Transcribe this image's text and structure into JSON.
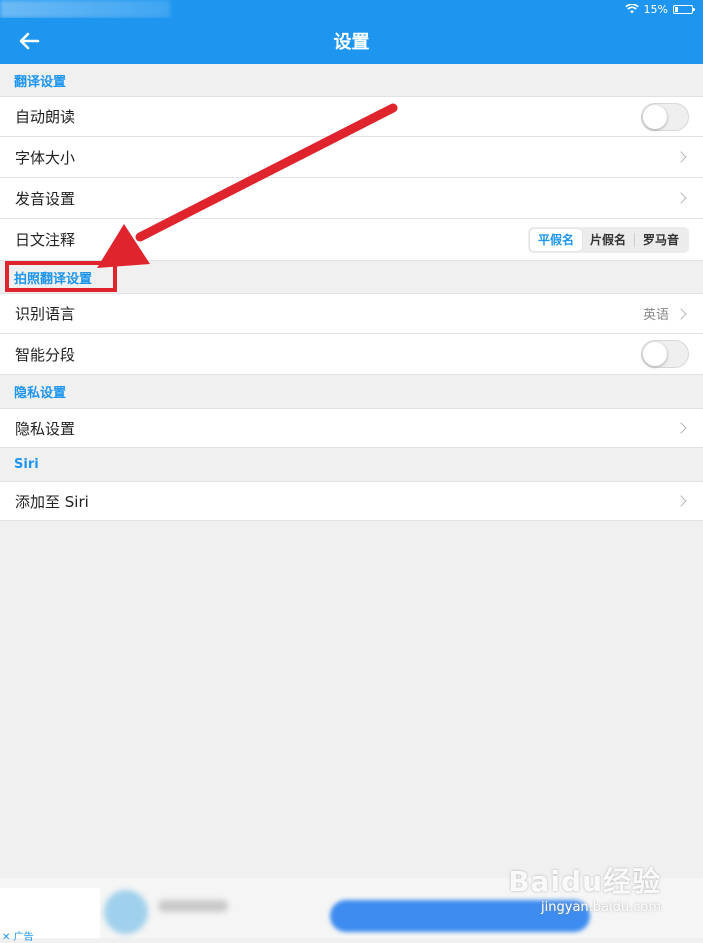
{
  "status_bar": {
    "battery_text": "15%"
  },
  "nav": {
    "title": "设置"
  },
  "sections": {
    "translation": {
      "title": "翻译设置",
      "rows": {
        "auto_read": {
          "label": "自动朗读",
          "toggle_on": false
        },
        "font_size": {
          "label": "字体大小"
        },
        "pronunciation": {
          "label": "发音设置"
        },
        "japanese_annotation": {
          "label": "日文注释",
          "options": [
            "平假名",
            "片假名",
            "罗马音"
          ],
          "selected": "平假名"
        }
      }
    },
    "photo_translation": {
      "title": "拍照翻译设置",
      "rows": {
        "recognize_language": {
          "label": "识别语言",
          "value": "英语"
        },
        "smart_paragraph": {
          "label": "智能分段",
          "toggle_on": false
        }
      }
    },
    "privacy": {
      "title": "隐私设置",
      "rows": {
        "privacy_settings": {
          "label": "隐私设置"
        }
      }
    },
    "siri": {
      "title": "Siri",
      "rows": {
        "add_to_siri": {
          "label": "添加至 Siri"
        }
      }
    }
  },
  "ad": {
    "label": "广告"
  },
  "watermark": {
    "main": "Baidu经验",
    "sub": "jingyan.baidu.com"
  },
  "colors": {
    "accent": "#1e96f0",
    "annotation_red": "#e0242e"
  },
  "icons": [
    "back-arrow-icon",
    "wifi-icon",
    "battery-icon",
    "chevron-right-icon",
    "close-icon"
  ]
}
